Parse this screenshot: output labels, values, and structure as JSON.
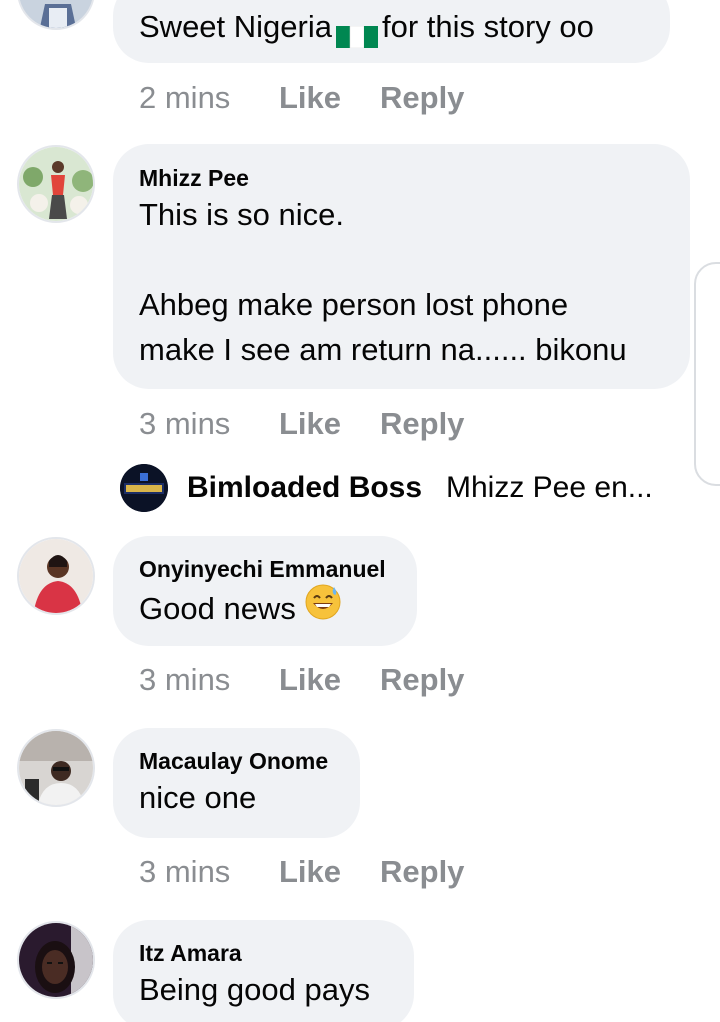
{
  "actions_labels": {
    "like": "Like",
    "reply": "Reply"
  },
  "comments": [
    {
      "author": "",
      "lines": [
        "Sweet Nigeria",
        "for this story oo"
      ],
      "time": "2 mins",
      "avatar_icon": "profile-photo"
    },
    {
      "author": "Mhizz Pee",
      "lines": [
        "This is so nice.",
        "",
        "Ahbeg make person lost phone",
        "make I see am return na...... bikonu"
      ],
      "time": "3 mins",
      "avatar_icon": "profile-photo"
    },
    {
      "author": "Onyinyechi Emmanuel",
      "lines": [
        "Good news"
      ],
      "time": "3 mins",
      "avatar_icon": "profile-photo"
    },
    {
      "author": "Macaulay Onome",
      "lines": [
        "nice one"
      ],
      "time": "3 mins",
      "avatar_icon": "profile-photo"
    },
    {
      "author": "Itz Amara",
      "lines": [
        "Being good pays"
      ],
      "time": "",
      "avatar_icon": "profile-photo"
    }
  ],
  "reply_preview": {
    "author": "Bimloaded Boss",
    "snippet": "Mhizz Pee en...",
    "avatar_icon": "bimloaded-logo"
  },
  "emojis": {
    "flag": "nigeria-flag-icon",
    "smile": "grinning-sweat-emoji-icon"
  },
  "colors": {
    "bubble": "#f0f2f5",
    "meta": "#8a8d91",
    "text": "#050505",
    "flag_green": "#008751"
  }
}
